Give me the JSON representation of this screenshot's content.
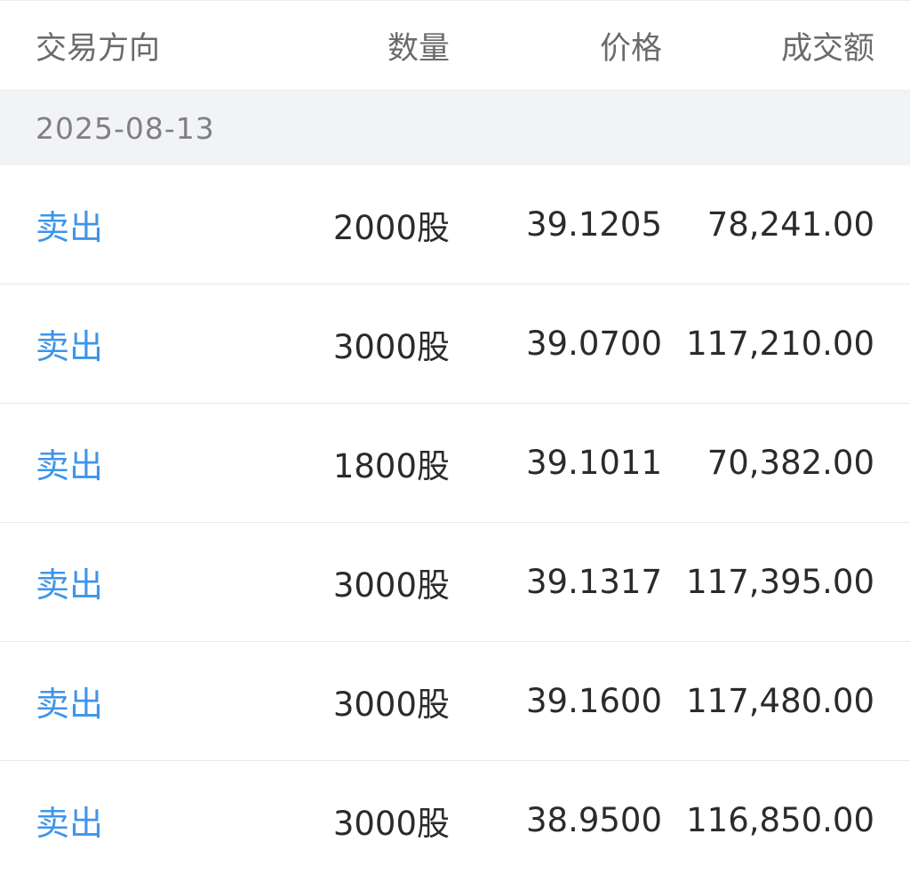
{
  "header": {
    "direction": "交易方向",
    "quantity": "数量",
    "price": "价格",
    "amount": "成交额"
  },
  "date_group": {
    "date": "2025-08-13"
  },
  "trades": [
    {
      "direction": "卖出",
      "quantity": "2000股",
      "price": "39.1205",
      "amount": "78,241.00"
    },
    {
      "direction": "卖出",
      "quantity": "3000股",
      "price": "39.0700",
      "amount": "117,210.00"
    },
    {
      "direction": "卖出",
      "quantity": "1800股",
      "price": "39.1011",
      "amount": "70,382.00"
    },
    {
      "direction": "卖出",
      "quantity": "3000股",
      "price": "39.1317",
      "amount": "117,395.00"
    },
    {
      "direction": "卖出",
      "quantity": "3000股",
      "price": "39.1600",
      "amount": "117,480.00"
    },
    {
      "direction": "卖出",
      "quantity": "3000股",
      "price": "38.9500",
      "amount": "116,850.00"
    }
  ],
  "colors": {
    "sell": "#3f95e8",
    "text": "#2b2b2b",
    "header_text": "#6b6b6b",
    "date_bg": "#f2f3f6"
  }
}
